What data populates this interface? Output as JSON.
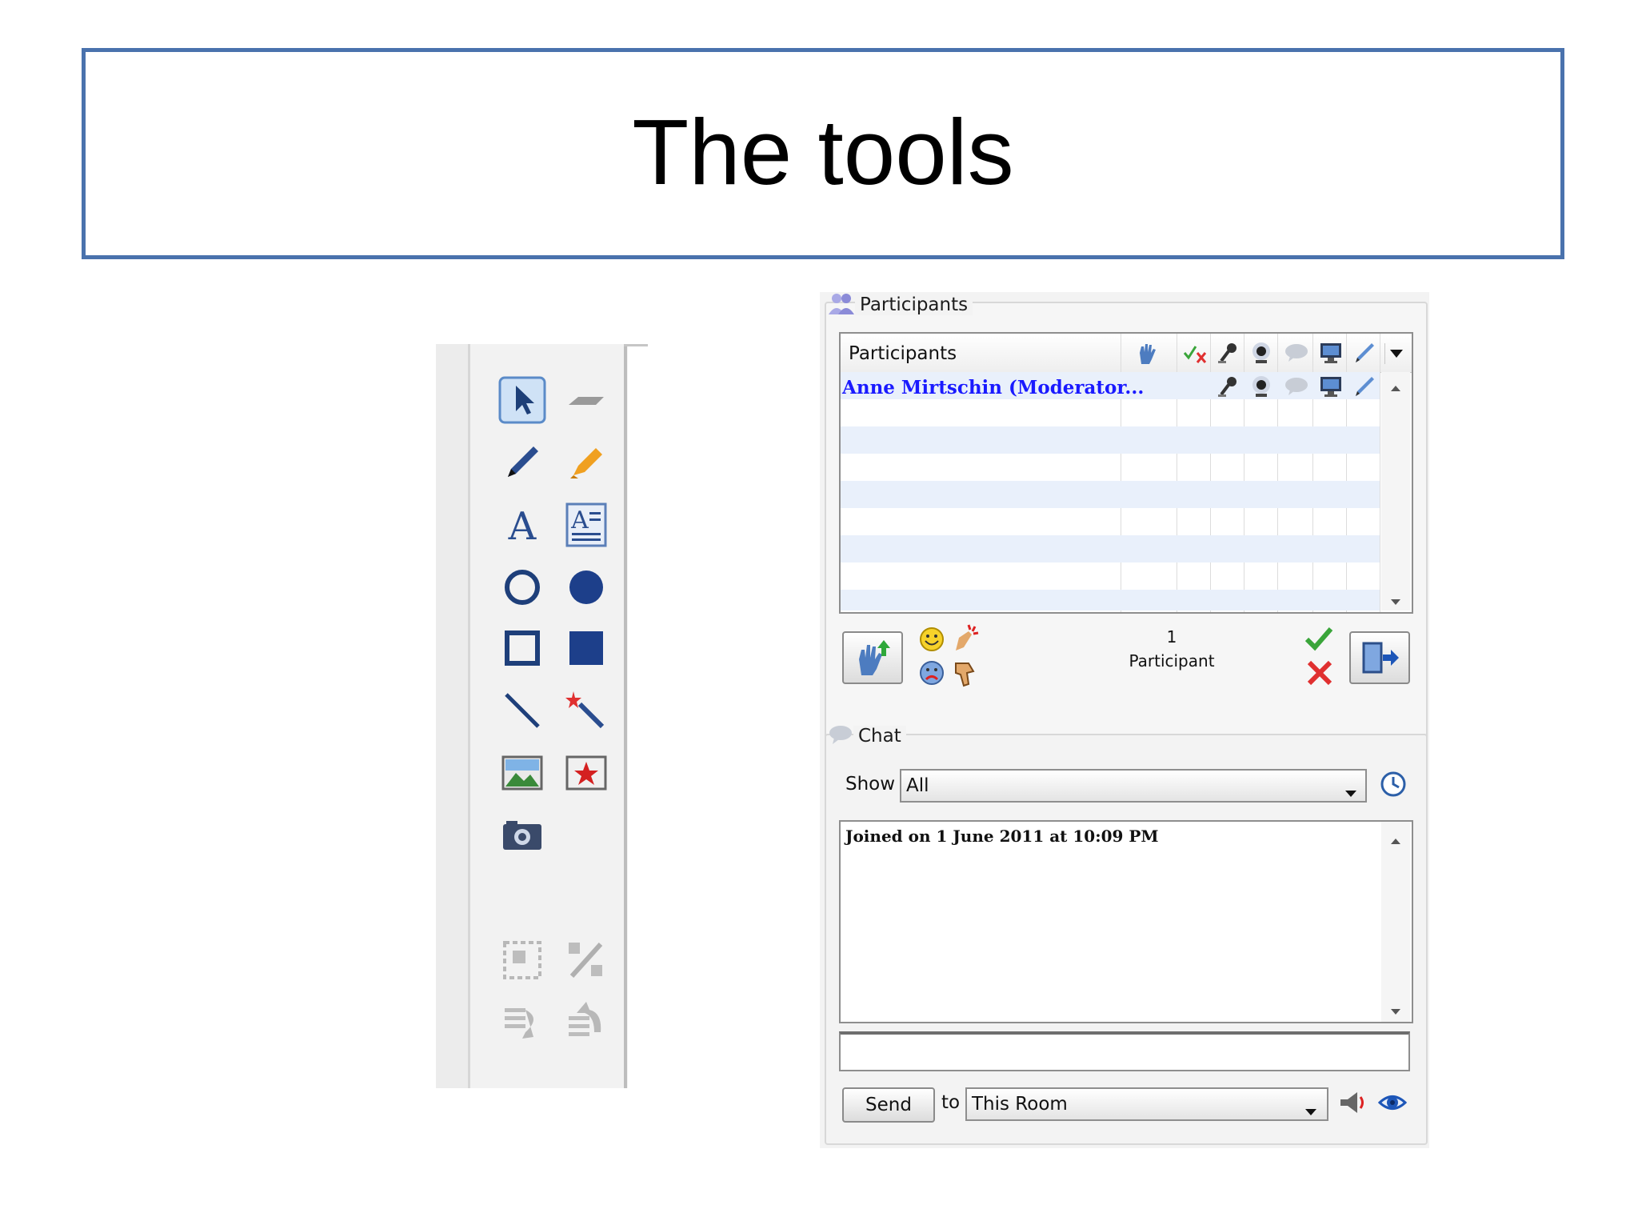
{
  "slide": {
    "title": "The tools"
  },
  "toolbar": {
    "tools": [
      "select-arrow-icon",
      "eraser-icon",
      "pen-icon",
      "highlighter-icon",
      "text-icon",
      "text-box-icon",
      "circle-outline-icon",
      "circle-filled-icon",
      "square-outline-icon",
      "square-filled-icon",
      "line-icon",
      "magic-wand-icon",
      "image-icon",
      "stamp-icon",
      "camera-icon",
      "selection-icon",
      "percent-icon",
      "undo-icon",
      "redo-icon"
    ]
  },
  "participants": {
    "section_title": "Participants",
    "column_header": "Participants",
    "rows": [
      {
        "name": "Anne Mirtschin (Moderator..."
      }
    ],
    "count": "1",
    "count_label": "Participant"
  },
  "chat": {
    "section_title": "Chat",
    "show_label": "Show",
    "show_value": "All",
    "messages": [
      "Joined on 1 June 2011 at 10:09 PM"
    ],
    "input_value": "",
    "send_label": "Send",
    "to_label": "to",
    "to_value": "This Room"
  },
  "colors": {
    "title_border": "#4a72ad",
    "moderator_name": "#1a1aff",
    "row_alt": "#e9f0fb"
  }
}
